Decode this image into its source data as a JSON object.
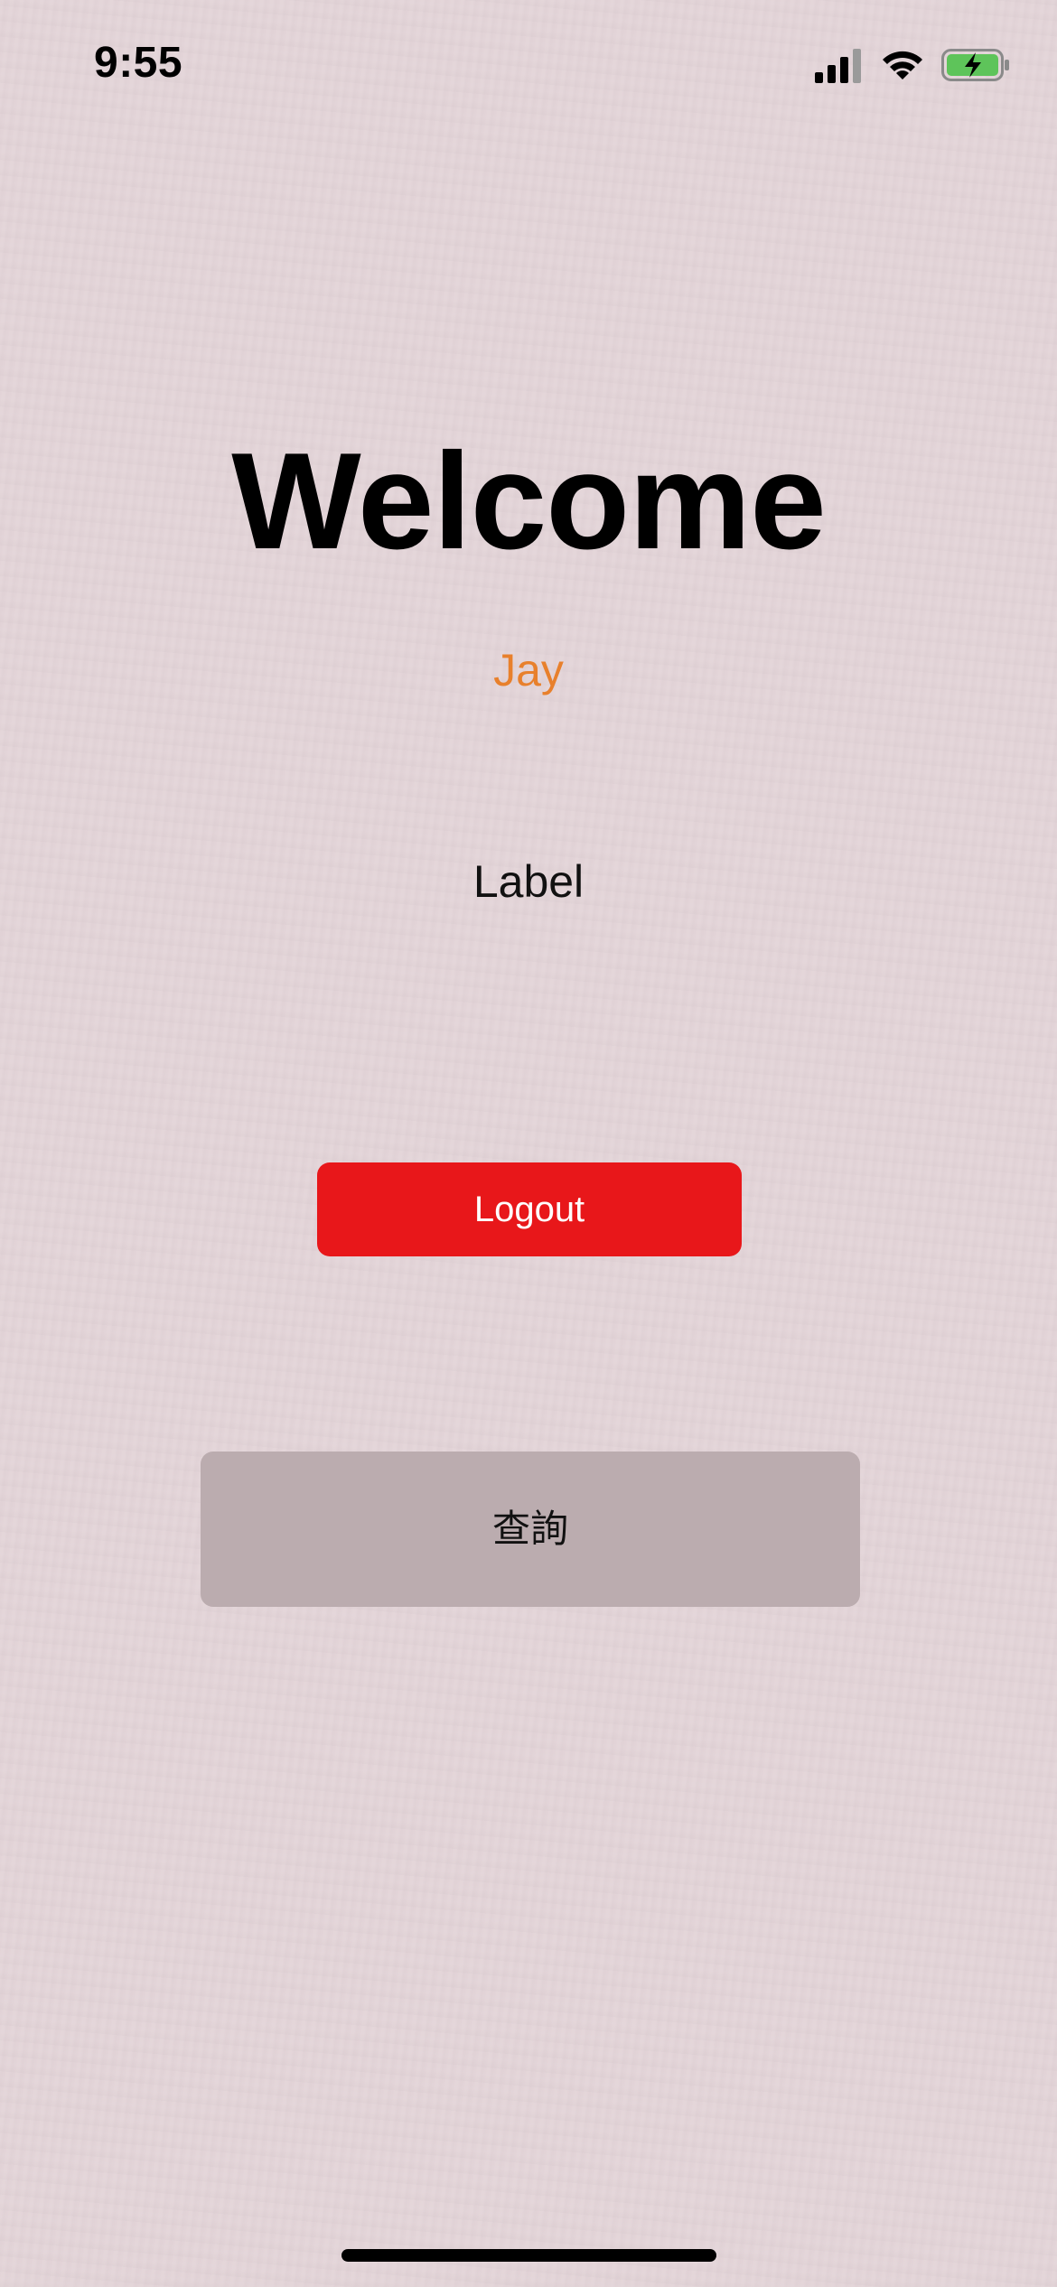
{
  "status_bar": {
    "time": "9:55",
    "icons": [
      "cellular-signal-icon",
      "wifi-icon",
      "battery-charging-icon"
    ],
    "battery_color": "#5ec45a"
  },
  "main": {
    "title": "Welcome",
    "user_name": "Jay",
    "user_name_color": "#e8802c",
    "label": "Label",
    "logout_label": "Logout",
    "logout_color": "#e8171a",
    "query_label": "查詢",
    "query_color": "#bbacaf"
  },
  "background_color": "#e3d4d8"
}
